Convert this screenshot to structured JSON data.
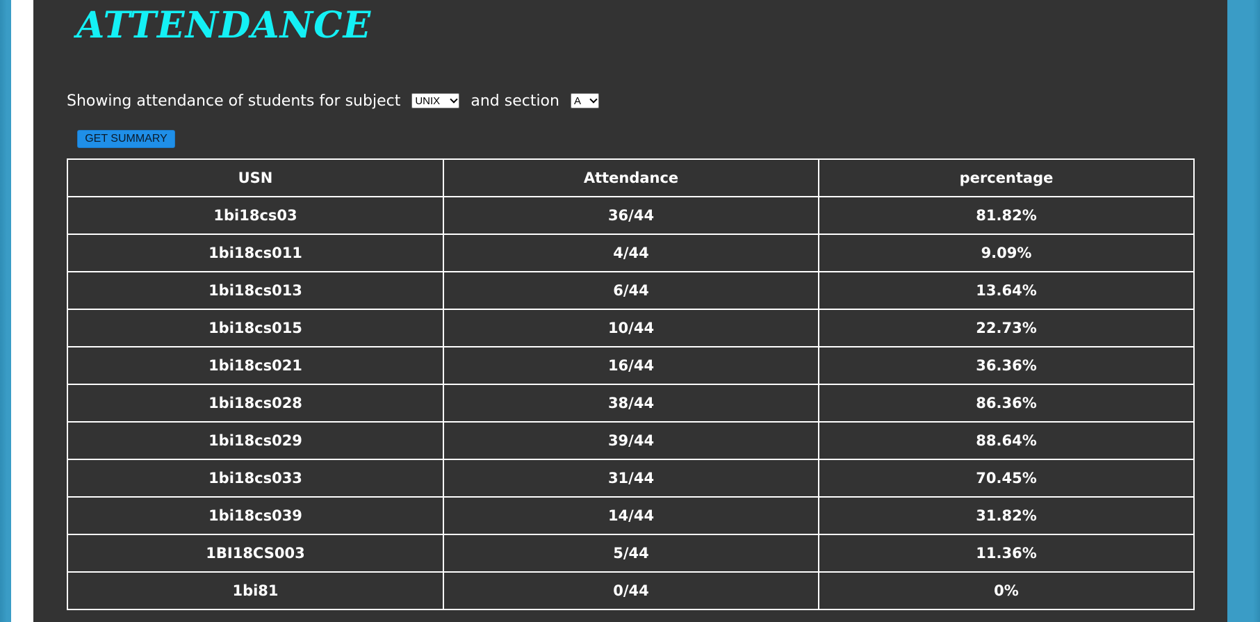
{
  "page": {
    "title": "ATTENDANCE"
  },
  "filters": {
    "prefix_text": "Showing attendance of students for subject",
    "subject_selected": "UNIX",
    "middle_text": "and section",
    "section_selected": "A",
    "summary_button_label": "GET SUMMARY"
  },
  "table": {
    "headers": [
      "USN",
      "Attendance",
      "percentage"
    ],
    "rows": [
      [
        "1bi18cs03",
        "36/44",
        "81.82%"
      ],
      [
        "1bi18cs011",
        "4/44",
        "9.09%"
      ],
      [
        "1bi18cs013",
        "6/44",
        "13.64%"
      ],
      [
        "1bi18cs015",
        "10/44",
        "22.73%"
      ],
      [
        "1bi18cs021",
        "16/44",
        "36.36%"
      ],
      [
        "1bi18cs028",
        "38/44",
        "86.36%"
      ],
      [
        "1bi18cs029",
        "39/44",
        "88.64%"
      ],
      [
        "1bi18cs033",
        "31/44",
        "70.45%"
      ],
      [
        "1bi18cs039",
        "14/44",
        "31.82%"
      ],
      [
        "1BI18CS003",
        "5/44",
        "11.36%"
      ],
      [
        "1bi81",
        "0/44",
        "0%"
      ]
    ]
  },
  "colors": {
    "title": "#14f0f5",
    "panel_background": "#333333",
    "button_background": "#1f8fe8",
    "page_background": "#3a9cc6"
  }
}
